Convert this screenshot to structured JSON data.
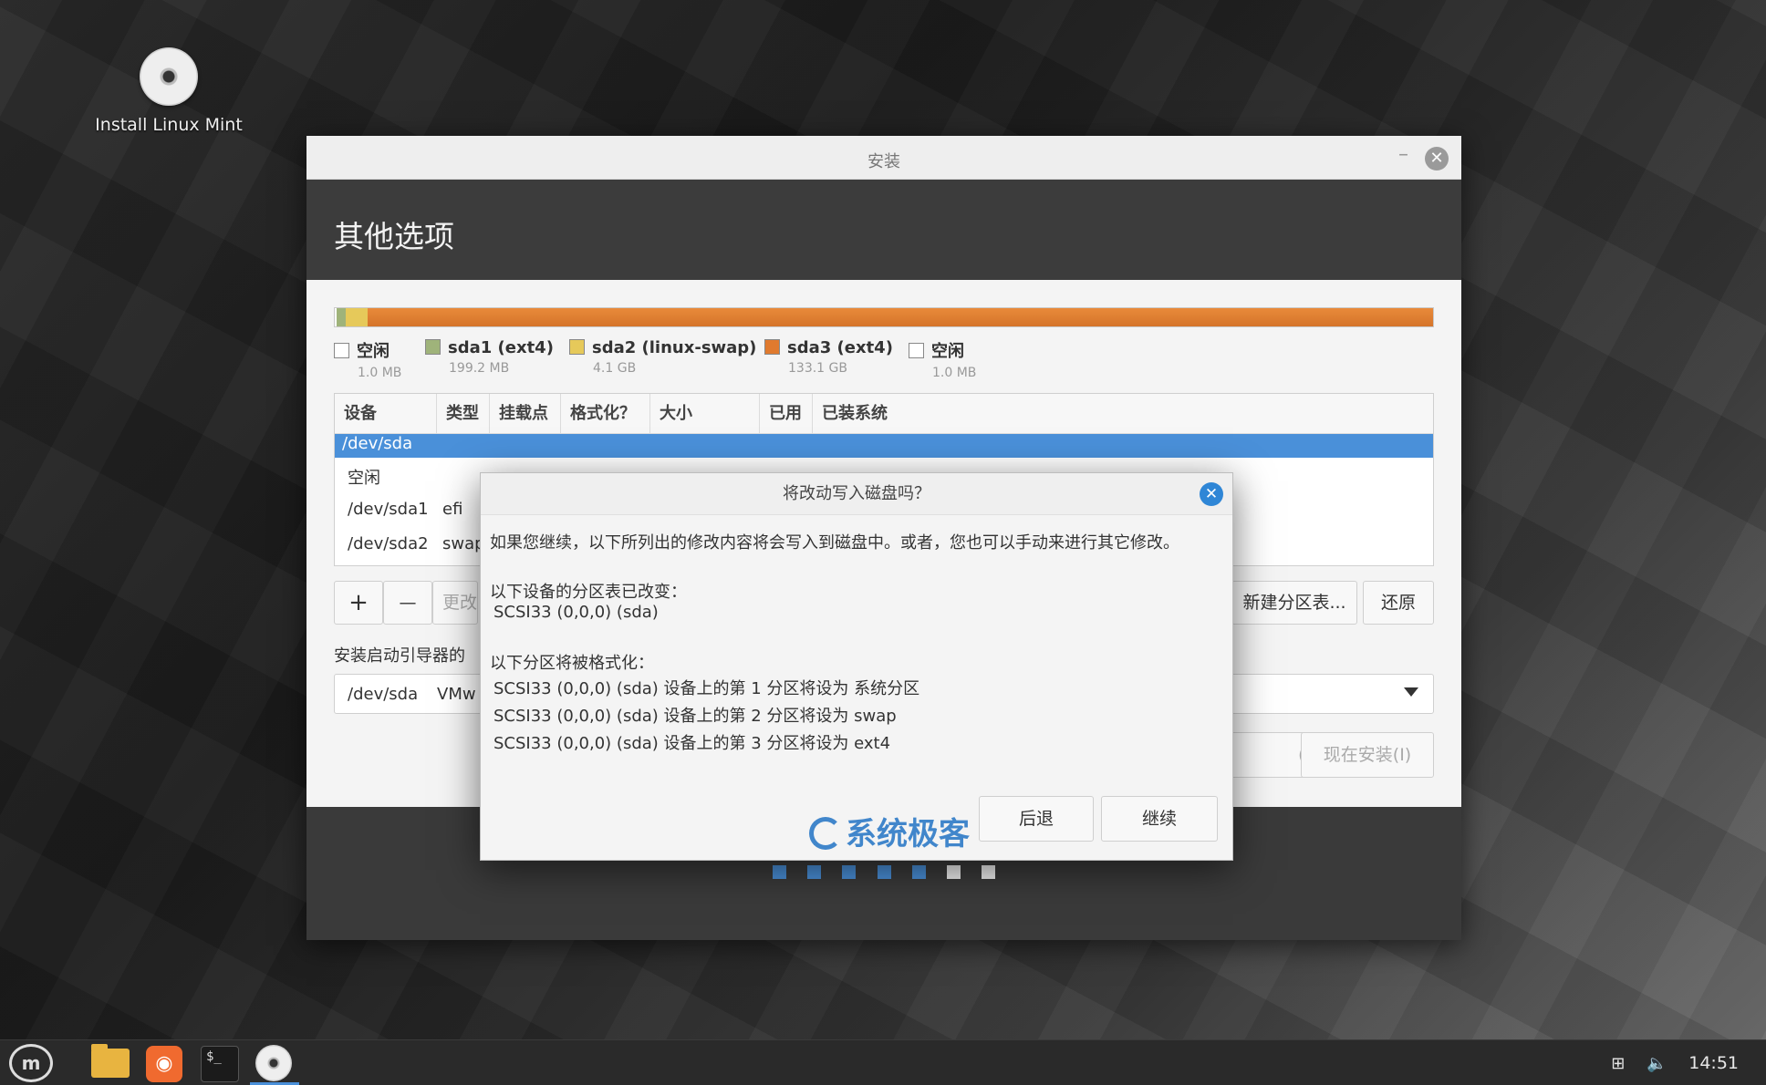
{
  "desktop": {
    "icon_label": "Install Linux Mint"
  },
  "window": {
    "title": "安装",
    "page_title": "其他选项"
  },
  "legend": [
    {
      "name": "空闲",
      "size": "1.0 MB",
      "color": "#ffffff"
    },
    {
      "name": "sda1 (ext4)",
      "size": "199.2 MB",
      "color": "#9fb37a"
    },
    {
      "name": "sda2 (linux-swap)",
      "size": "4.1 GB",
      "color": "#e6c95a"
    },
    {
      "name": "sda3 (ext4)",
      "size": "133.1 GB",
      "color": "#e07a2e"
    },
    {
      "name": "空闲",
      "size": "1.0 MB",
      "color": "#ffffff"
    }
  ],
  "table": {
    "columns": [
      "设备",
      "类型",
      "挂载点",
      "格式化？",
      "大小",
      "已用",
      "已装系统"
    ],
    "rows": [
      {
        "device": "/dev/sda",
        "type": ""
      },
      {
        "device": "空闲",
        "type": ""
      },
      {
        "device": "/dev/sda1",
        "type": "efi"
      },
      {
        "device": "/dev/sda2",
        "type": "swap"
      }
    ]
  },
  "buttons": {
    "add": "+",
    "remove": "—",
    "change": "更改",
    "new_table": "新建分区表...",
    "revert": "还原",
    "back_partial": "(B)",
    "install_now": "现在安装(I)"
  },
  "boot": {
    "label": "安装启动引导器的",
    "device": "/dev/sda",
    "device_desc": "VMw"
  },
  "progress_dots": {
    "total": 7,
    "done": 5
  },
  "dialog": {
    "title": "将改动写入磁盘吗？",
    "intro": "如果您继续，以下所列出的修改内容将会写入到磁盘中。或者，您也可以手动来进行其它修改。",
    "section1": "以下设备的分区表已改变：",
    "section1_item": "SCSI33 (0,0,0) (sda)",
    "section2": "以下分区将被格式化：",
    "section2_items": [
      "SCSI33 (0,0,0) (sda) 设备上的第 1 分区将设为 系统分区",
      "SCSI33 (0,0,0) (sda) 设备上的第 2 分区将设为 swap",
      "SCSI33 (0,0,0) (sda) 设备上的第 3 分区将设为 ext4"
    ],
    "back": "后退",
    "continue": "继续",
    "watermark": "系统极客"
  },
  "taskbar": {
    "clock": "14:51"
  }
}
